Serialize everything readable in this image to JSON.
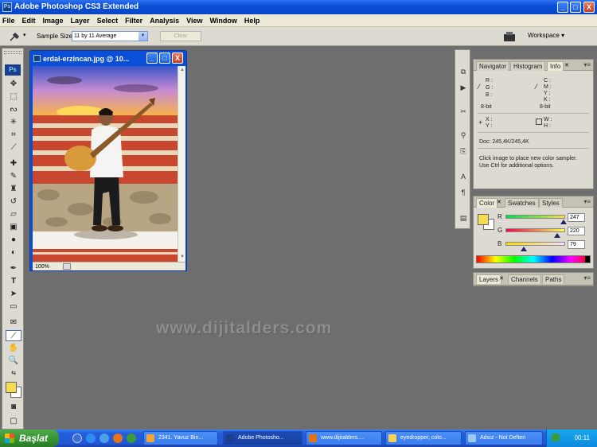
{
  "window": {
    "app_icon": "Ps",
    "title": "Adobe Photoshop CS3 Extended",
    "controls": {
      "minimize": "_",
      "maximize": "□",
      "close": "X"
    }
  },
  "menu": [
    "File",
    "Edit",
    "Image",
    "Layer",
    "Select",
    "Filter",
    "Analysis",
    "View",
    "Window",
    "Help"
  ],
  "options_bar": {
    "tool_icon": "eyedropper-icon",
    "sample_size_label": "Sample Size:",
    "sample_size_value": "11 by 11 Average",
    "clear_button": "Clear",
    "workspace_label": "Workspace ▾"
  },
  "toolbox": {
    "logo": "Ps",
    "tools": [
      "move-icon",
      "marquee-icon",
      "lasso-icon",
      "magic-wand-icon",
      "crop-icon",
      "slice-icon",
      "healing-brush-icon",
      "brush-icon",
      "clone-stamp-icon",
      "history-brush-icon",
      "eraser-icon",
      "gradient-icon",
      "blur-icon",
      "dodge-icon",
      "pen-icon",
      "type-icon",
      "path-selection-icon",
      "shape-icon",
      "notes-icon",
      "eyedropper-icon",
      "hand-icon",
      "zoom-icon"
    ],
    "foreground_color": "#f7dc4f",
    "background_color": "#ffffff"
  },
  "document": {
    "title": "erdal-erzincan.jpg @ 10...",
    "zoom": "100%"
  },
  "info_panel": {
    "tabs": [
      "Navigator",
      "Histogram",
      "Info"
    ],
    "active_tab": "Info",
    "rgb_labels": [
      "R :",
      "G :",
      "B :"
    ],
    "cmyk_labels": [
      "C :",
      "M :",
      "Y :",
      "K :"
    ],
    "bit_left": "8-bit",
    "bit_right": "8-bit",
    "xy_labels": [
      "X :",
      "Y :"
    ],
    "wh_labels": [
      "W :",
      "H :"
    ],
    "doc_size": "Doc: 245,4K/245,4K",
    "hint_line1": "Click image to place new color sampler.",
    "hint_line2": "Use Ctrl for additional options."
  },
  "color_panel": {
    "tabs": [
      "Color",
      "Swatches",
      "Styles"
    ],
    "active_tab": "Color",
    "channels": [
      {
        "label": "R",
        "value": "247",
        "level": 0.97
      },
      {
        "label": "G",
        "value": "220",
        "level": 0.86
      },
      {
        "label": "B",
        "value": "79",
        "level": 0.31
      }
    ],
    "swatch_color": "#f7dc4f"
  },
  "layers_panel": {
    "tabs": [
      "Layers",
      "Channels",
      "Paths"
    ],
    "active_tab": "Layers"
  },
  "watermark": "www.dijitalders.com",
  "taskbar": {
    "start_label": "Başlat",
    "buttons": [
      "2341. Yavuz Bin...",
      "Adobe Photosho...",
      "www.dijitalders....",
      "eyedropper, colo...",
      "Adsız - Not Defteri"
    ],
    "active_button": 1,
    "clock": "00:11"
  }
}
